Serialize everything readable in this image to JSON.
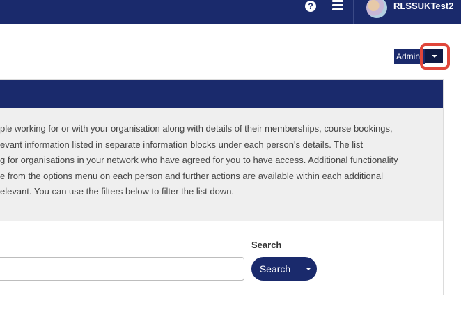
{
  "topnav": {
    "help_symbol": "?",
    "username": "RLSSUKTest2"
  },
  "admin": {
    "button_label": "Admin"
  },
  "panel": {
    "description_lines": [
      "ple working for or with your organisation along with details of their memberships, course bookings,",
      "evant information listed in separate information blocks under each person's details. The list",
      "g for organisations in your network who have agreed for you to have access. Additional functionality",
      "e from the options menu on each person and further actions are available within each additional",
      "elevant. You can use the filters below to filter the list down."
    ]
  },
  "search": {
    "label": "Search",
    "input_value": "",
    "button_label": "Search"
  },
  "colors": {
    "nav": "#1a2a6c",
    "highlight": "#e0463a",
    "desc_bg": "#efefef"
  }
}
